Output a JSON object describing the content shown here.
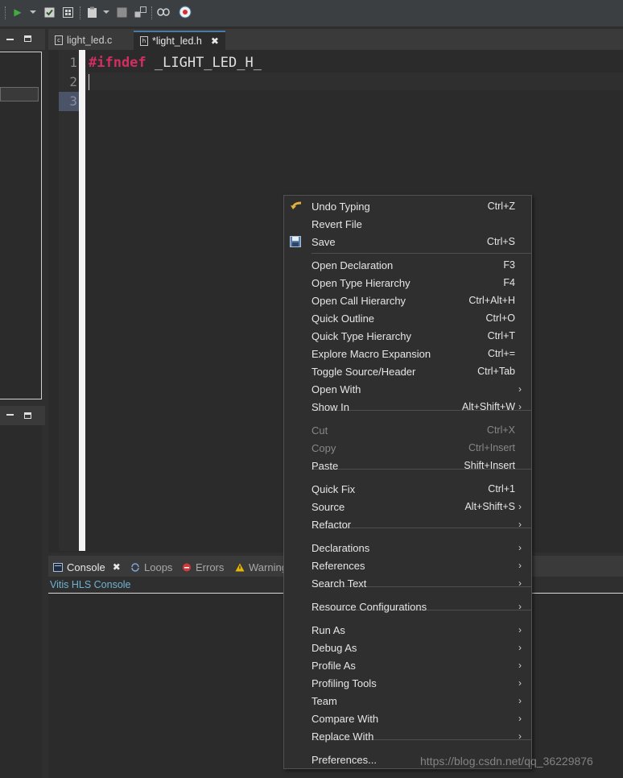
{
  "toolbar": {
    "icons": [
      "run-icon",
      "dropdown-icon",
      "checkbox-icon",
      "grid-icon",
      "clipboard-icon",
      "stop-icon",
      "layers-icon",
      "chain-icon",
      "help-bubble-icon"
    ]
  },
  "editor": {
    "tabs": [
      {
        "label": "light_led.c",
        "active": false,
        "icon": "c-file-icon"
      },
      {
        "label": "*light_led.h",
        "active": true,
        "icon": "h-file-icon"
      }
    ],
    "line_numbers": [
      "1",
      "2",
      "3"
    ],
    "code": {
      "keyword": "#ifndef",
      "identifier": " _LIGHT_LED_H_"
    }
  },
  "console": {
    "tabs": [
      {
        "label": "Console",
        "active": true
      },
      {
        "label": "Loops",
        "active": false
      },
      {
        "label": "Errors",
        "active": false
      },
      {
        "label": "Warnings",
        "active": false
      }
    ],
    "title": "Vitis HLS Console"
  },
  "context_menu": {
    "items": [
      {
        "label": "Undo Typing",
        "shortcut": "Ctrl+Z",
        "icon": "undo-icon"
      },
      {
        "label": "Revert File",
        "shortcut": ""
      },
      {
        "label": "Save",
        "shortcut": "Ctrl+S",
        "icon": "save-icon"
      },
      {
        "label": "Open Declaration",
        "shortcut": "F3"
      },
      {
        "label": "Open Type Hierarchy",
        "shortcut": "F4"
      },
      {
        "label": "Open Call Hierarchy",
        "shortcut": "Ctrl+Alt+H"
      },
      {
        "label": "Quick Outline",
        "shortcut": "Ctrl+O"
      },
      {
        "label": "Quick Type Hierarchy",
        "shortcut": "Ctrl+T"
      },
      {
        "label": "Explore Macro Expansion",
        "shortcut": "Ctrl+="
      },
      {
        "label": "Toggle Source/Header",
        "shortcut": "Ctrl+Tab"
      },
      {
        "label": "Open With",
        "submenu": true
      },
      {
        "label": "Show In",
        "shortcut": "Alt+Shift+W",
        "submenu": true
      },
      {
        "label": "Cut",
        "shortcut": "Ctrl+X",
        "disabled": true
      },
      {
        "label": "Copy",
        "shortcut": "Ctrl+Insert",
        "disabled": true
      },
      {
        "label": "Paste",
        "shortcut": "Shift+Insert"
      },
      {
        "label": "Quick Fix",
        "shortcut": "Ctrl+1"
      },
      {
        "label": "Source",
        "shortcut": "Alt+Shift+S",
        "submenu": true
      },
      {
        "label": "Refactor",
        "submenu": true
      },
      {
        "label": "Declarations",
        "submenu": true
      },
      {
        "label": "References",
        "submenu": true
      },
      {
        "label": "Search Text",
        "submenu": true
      },
      {
        "label": "Resource Configurations",
        "submenu": true
      },
      {
        "label": "Run As",
        "submenu": true
      },
      {
        "label": "Debug As",
        "submenu": true
      },
      {
        "label": "Profile As",
        "submenu": true
      },
      {
        "label": "Profiling Tools",
        "submenu": true
      },
      {
        "label": "Team",
        "submenu": true
      },
      {
        "label": "Compare With",
        "submenu": true
      },
      {
        "label": "Replace With",
        "submenu": true
      },
      {
        "label": "Preferences..."
      }
    ]
  },
  "watermark": "https://blog.csdn.net/qq_36229876",
  "colors": {
    "keyword": "#d12e61",
    "console_title": "#6fb3d2",
    "tab_accent": "#4a7ba7"
  }
}
